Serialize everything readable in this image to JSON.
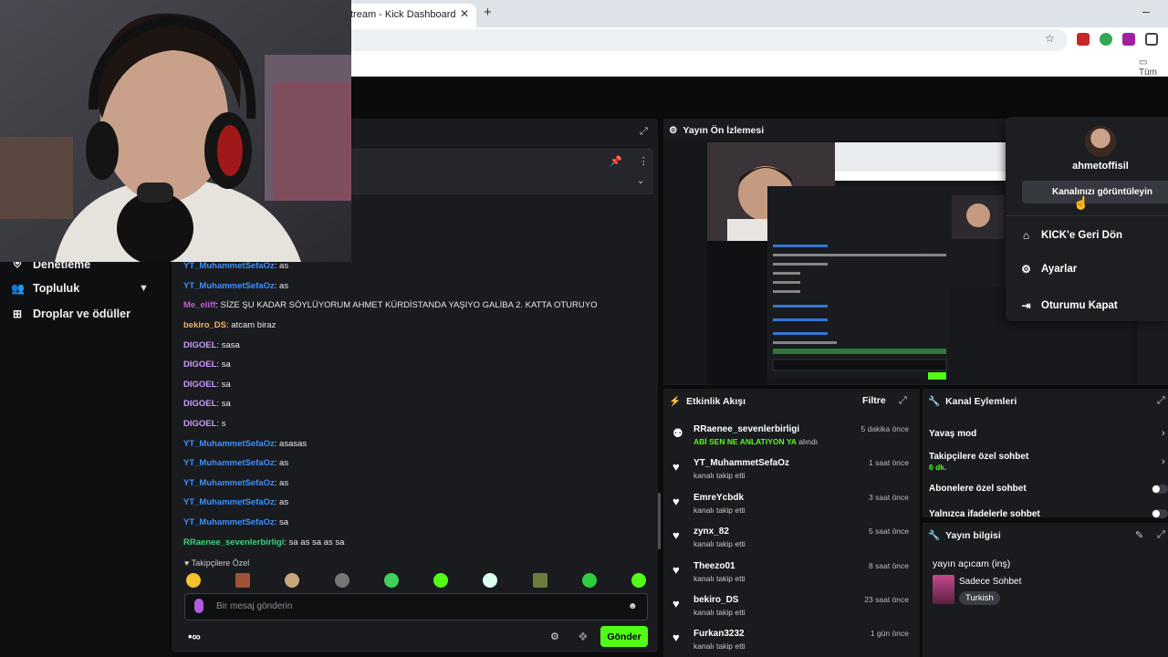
{
  "browser": {
    "tab_title": "tream - Kick Dashboard",
    "bookmark_label": "Tüm"
  },
  "sidebar": {
    "items": [
      {
        "label": "Denetleme",
        "icon": "shield-icon"
      },
      {
        "label": "Topluluk",
        "icon": "community-icon"
      },
      {
        "label": "Droplar ve ödüller",
        "icon": "gift-icon"
      }
    ]
  },
  "chat": {
    "messages": [
      {
        "user": "YT_MuhammetSefaOz",
        "color": "#3d8fff",
        "text": "as"
      },
      {
        "user": "YT_MuhammetSefaOz",
        "color": "#3d8fff",
        "text": "as"
      },
      {
        "user": "Me_eliff",
        "color": "#c15bd8",
        "text": "SİZE ŞU KADAR SÖYLÜYORUM AHMET KÜRDİSTANDA YAŞIYO GALİBA 2. KATTA OTURUYO"
      },
      {
        "user": "bekiro_DS",
        "color": "#f0b36b",
        "text": "atcam biraz"
      },
      {
        "user": "DIGOEL",
        "color": "#c79bff",
        "text": "sasa"
      },
      {
        "user": "DIGOEL",
        "color": "#c79bff",
        "text": "sa"
      },
      {
        "user": "DIGOEL",
        "color": "#c79bff",
        "text": "sa"
      },
      {
        "user": "DIGOEL",
        "color": "#c79bff",
        "text": "sa"
      },
      {
        "user": "DIGOEL",
        "color": "#c79bff",
        "text": "s"
      },
      {
        "user": "YT_MuhammetSefaOz",
        "color": "#3d8fff",
        "text": "asasas"
      },
      {
        "user": "YT_MuhammetSefaOz",
        "color": "#3d8fff",
        "text": "as"
      },
      {
        "user": "YT_MuhammetSefaOz",
        "color": "#3d8fff",
        "text": "as"
      },
      {
        "user": "YT_MuhammetSefaOz",
        "color": "#3d8fff",
        "text": "as"
      },
      {
        "user": "YT_MuhammetSefaOz",
        "color": "#3d8fff",
        "text": "sa"
      },
      {
        "user": "RRaenee_sevenlerbirligi",
        "color": "#3fd17a",
        "text": "sa as sa as sa"
      }
    ],
    "followers_only_label": "Takipçilere Özel",
    "input_placeholder": "Bir mesaj gönderin",
    "send_label": "Gönder",
    "accent": "#53fc18"
  },
  "preview": {
    "title": "Yayın Ön İzlemesi"
  },
  "events": {
    "title": "Etkinlik Akışı",
    "filter_label": "Filtre",
    "items": [
      {
        "name": "RRaenee_sevenlerbirligi",
        "highlight": "ABİ SEN NE ANLATIYON YA",
        "desc": " alındı",
        "time": "5 dakika önce",
        "icon": "redeem-icon"
      },
      {
        "name": "YT_MuhammetSefaOz",
        "desc": "kanalı takip etti",
        "time": "1 saat önce",
        "icon": "heart-icon"
      },
      {
        "name": "EmreYcbdk",
        "desc": "kanalı takip etti",
        "time": "3 saat önce",
        "icon": "heart-icon"
      },
      {
        "name": "zynx_82",
        "desc": "kanalı takip etti",
        "time": "5 saat önce",
        "icon": "heart-icon"
      },
      {
        "name": "Theezo01",
        "desc": "kanalı takip etti",
        "time": "8 saat önce",
        "icon": "heart-icon"
      },
      {
        "name": "bekiro_DS",
        "desc": "kanalı takip etti",
        "time": "23 saat önce",
        "icon": "heart-icon"
      },
      {
        "name": "Furkan3232",
        "desc": "kanalı takip etti",
        "time": "1 gün önce",
        "icon": "heart-icon"
      }
    ]
  },
  "actions": {
    "title": "Kanal Eylemleri",
    "slow_mode": "Yavaş mod",
    "followers_chat": "Takipçilere özel sohbet",
    "followers_chat_value": "6 dk.",
    "subscribers_chat": "Abonelere özel sohbet",
    "emotes_only": "Yalnızca ifadelerle sohbet"
  },
  "stream_info": {
    "title": "Yayın bilgisi",
    "stream_title": "yayın açıcam (inş)",
    "category": "Sadece Sohbet",
    "tag": "Turkish"
  },
  "profile_menu": {
    "username": "ahmetoffisil",
    "view_channel": "Kanalınızı görüntüleyin",
    "items": [
      {
        "label": "KICK'e Geri Dön",
        "icon": "home-icon"
      },
      {
        "label": "Ayarlar",
        "icon": "gear-icon"
      },
      {
        "label": "Oturumu Kapat",
        "icon": "logout-icon"
      }
    ]
  }
}
